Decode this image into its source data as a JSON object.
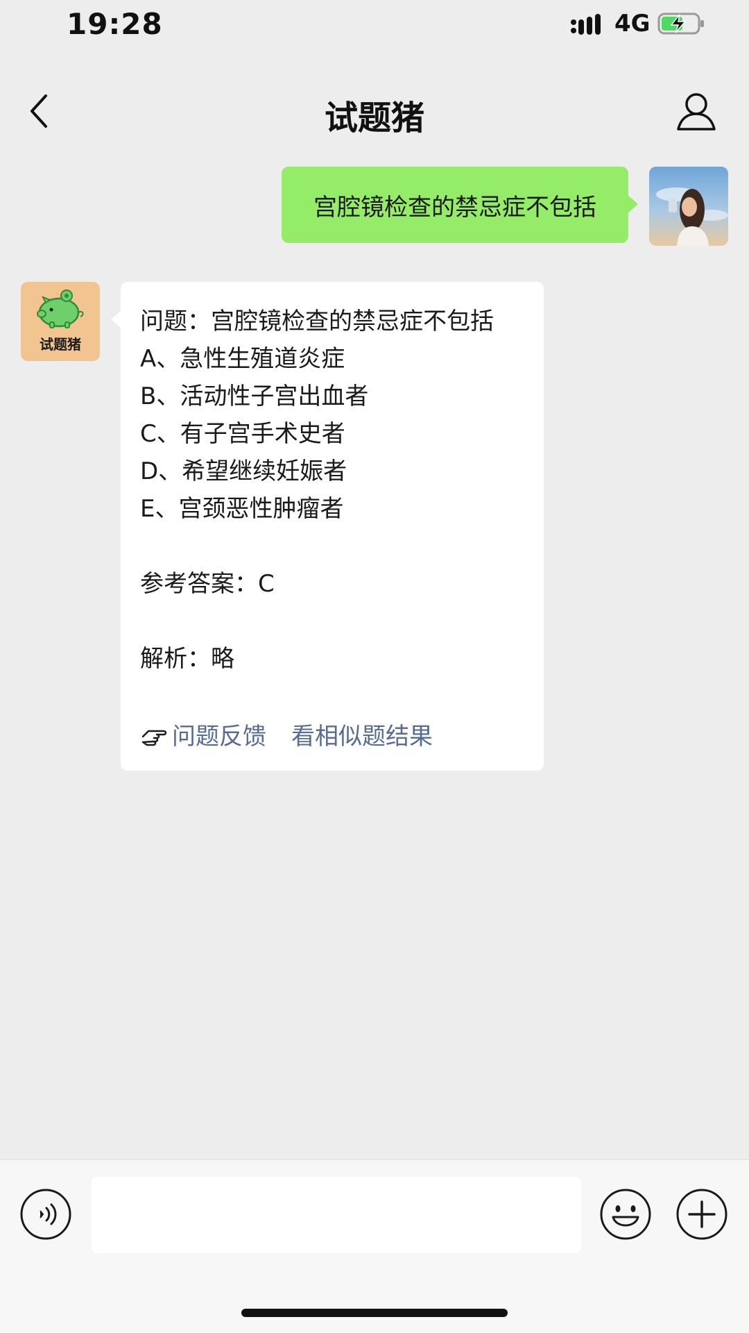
{
  "status_bar": {
    "time": "19:28",
    "network": "4G",
    "icons": [
      "signal-icon",
      "battery-charging-icon"
    ]
  },
  "nav": {
    "title": "试题猪",
    "icons": [
      "back-icon",
      "profile-icon"
    ]
  },
  "messages": {
    "outgoing": {
      "text": "宫腔镜检查的禁忌症不包括"
    },
    "bot": {
      "avatar_label": "试题猪",
      "question": "问题：宫腔镜检查的禁忌症不包括",
      "options": [
        "A、急性生殖道炎症",
        "B、活动性子宫出血者",
        "C、有子宫手术史者",
        "D、希望继续妊娠者",
        "E、宫颈恶性肿瘤者"
      ],
      "answer": "参考答案：C",
      "analysis": "解析：略",
      "links": [
        "问题反馈",
        "看相似题结果"
      ]
    }
  },
  "input_bar": {
    "text_value": "",
    "icons": [
      "voice-icon",
      "emoji-icon",
      "plus-icon"
    ]
  },
  "colors": {
    "background": "#ededed",
    "outgoing_bubble": "#95ec69",
    "incoming_bubble": "#ffffff",
    "link": "#576b95",
    "bot_avatar_bg": "#f2c490"
  }
}
